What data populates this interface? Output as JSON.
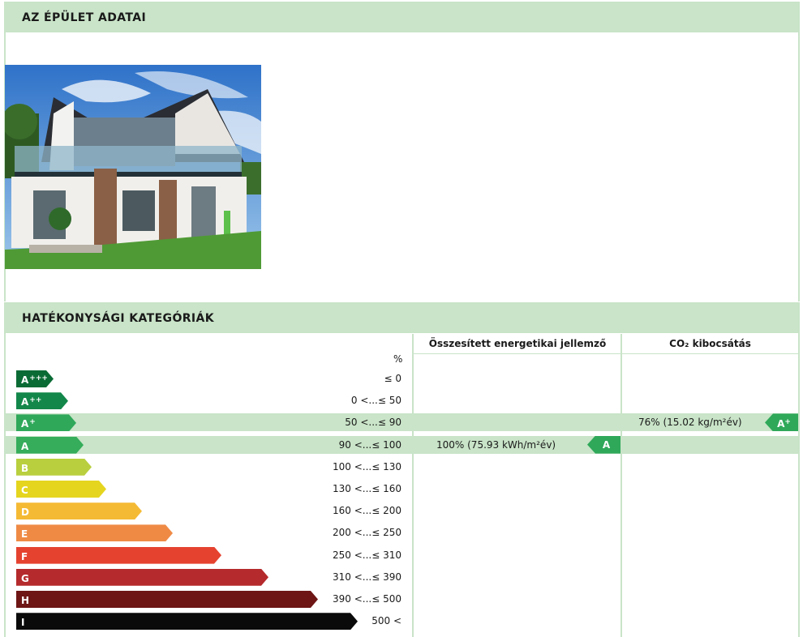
{
  "building": {
    "title": "AZ ÉPÜLET ADATAI"
  },
  "efficiency": {
    "title": "HATÉKONYSÁGI KATEGÓRIÁK",
    "col_energy": "Összesített energetikai jellemző",
    "col_co2": "CO₂ kibocsátás",
    "pct_label": "%",
    "categories": [
      {
        "label": "A",
        "sup": "+++",
        "range": "≤ 0",
        "color": "#0a6b35"
      },
      {
        "label": "A",
        "sup": "++",
        "range": "0 <...≤ 50",
        "color": "#13874a"
      },
      {
        "label": "A",
        "sup": "+",
        "range": "50 <...≤ 90",
        "color": "#2fa85a"
      },
      {
        "label": "A",
        "sup": "",
        "range": "90 <...≤ 100",
        "color": "#35ad5b"
      },
      {
        "label": "B",
        "sup": "",
        "range": "100 <...≤ 130",
        "color": "#b9cf3e"
      },
      {
        "label": "C",
        "sup": "",
        "range": "130 <...≤ 160",
        "color": "#e5d51f"
      },
      {
        "label": "D",
        "sup": "",
        "range": "160 <...≤ 200",
        "color": "#f5ba34"
      },
      {
        "label": "E",
        "sup": "",
        "range": "200 <...≤ 250",
        "color": "#ef8a45"
      },
      {
        "label": "F",
        "sup": "",
        "range": "250 <...≤ 310",
        "color": "#e5422f"
      },
      {
        "label": "G",
        "sup": "",
        "range": "310 <...≤ 390",
        "color": "#b52a2c"
      },
      {
        "label": "H",
        "sup": "",
        "range": "390 <...≤ 500",
        "color": "#6e1515"
      },
      {
        "label": "I",
        "sup": "",
        "range": "500 <",
        "color": "#0a0a0a"
      }
    ],
    "energy": {
      "text": "100% (75.93 kWh/m²év)",
      "badge": "A",
      "badge_color": "#2fa85a",
      "category_index": 3
    },
    "co2": {
      "text": "76% (15.02 kg/m²év)",
      "badge": "A",
      "badge_sup": "+",
      "badge_color": "#2fa85a",
      "category_index": 2
    }
  }
}
